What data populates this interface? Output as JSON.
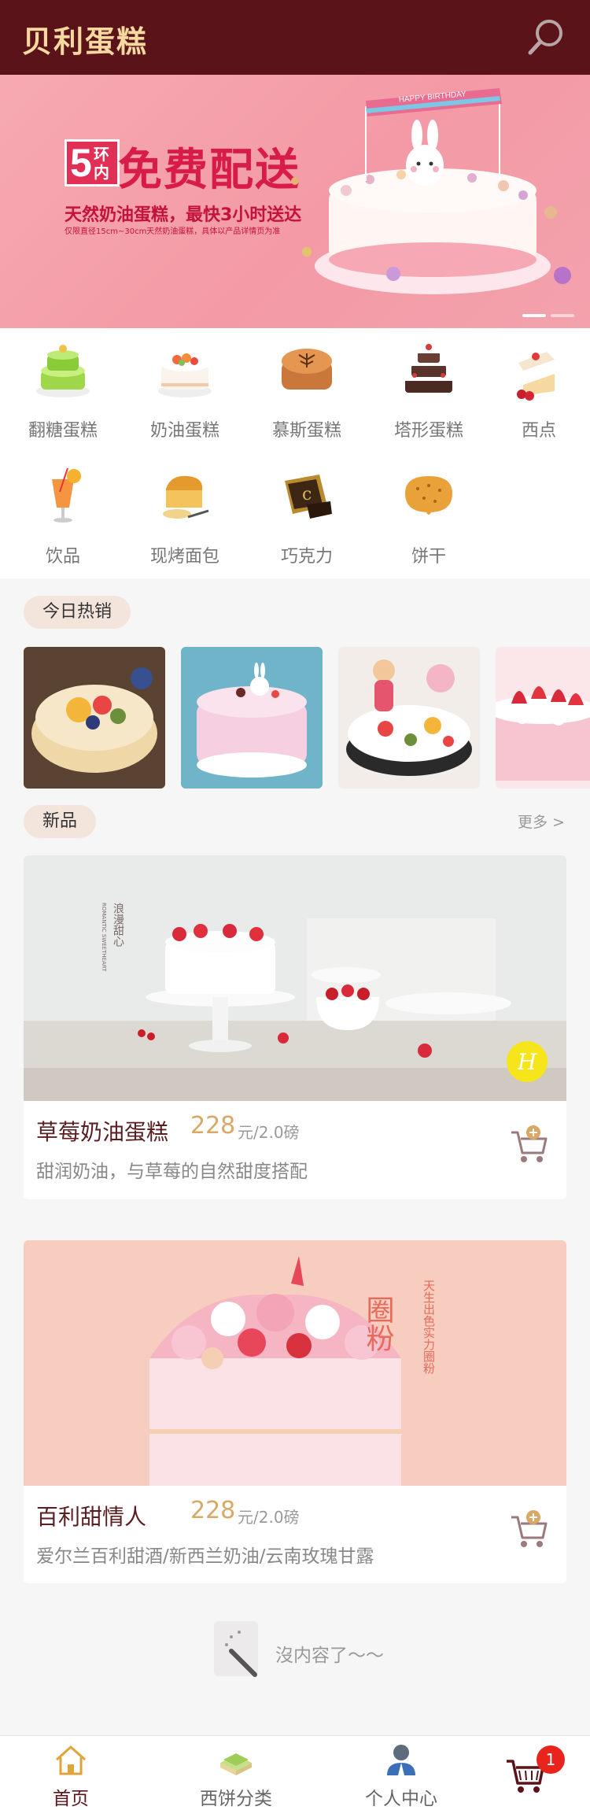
{
  "app": {
    "brand": "贝利蛋糕"
  },
  "banner": {
    "badge_number": "5",
    "badge_text": "环内",
    "title": "免费配送",
    "subtitle": "天然奶油蛋糕，最快3小时送达",
    "fine_print": "仅限直径15cm~30cm天然奶油蛋糕，具体以产品详情页为准",
    "topper_text": "HAPPY BIRTHDAY"
  },
  "categories": [
    {
      "label": "翻糖蛋糕",
      "icon": "fondant-cake-icon"
    },
    {
      "label": "奶油蛋糕",
      "icon": "cream-cake-icon"
    },
    {
      "label": "慕斯蛋糕",
      "icon": "mousse-cake-icon"
    },
    {
      "label": "塔形蛋糕",
      "icon": "tower-cake-icon"
    },
    {
      "label": "西点",
      "icon": "pastry-icon"
    },
    {
      "label": "饮品",
      "icon": "drink-icon"
    },
    {
      "label": "现烤面包",
      "icon": "bread-icon"
    },
    {
      "label": "巧克力",
      "icon": "chocolate-icon"
    },
    {
      "label": "饼干",
      "icon": "cookie-icon"
    }
  ],
  "hot": {
    "title": "今日热销"
  },
  "new_section": {
    "title": "新品",
    "more": "更多 >"
  },
  "products": [
    {
      "name": "草莓奶油蛋糕",
      "price": "228",
      "unit": "元/2.0磅",
      "desc": "甜润奶油，与草莓的自然甜度搭配",
      "photo_text_a": "浪漫甜心",
      "photo_text_b": "ROMANTIC SWEETHEART"
    },
    {
      "name": "百利甜情人",
      "price": "228",
      "unit": "元/2.0磅",
      "desc": "爱尔兰百利甜酒/新西兰奶油/云南玫瑰甘露",
      "photo_text_a": "圈粉",
      "photo_text_b": "天生出色实力圈粉"
    }
  ],
  "empty_text": "沒内容了～～",
  "tabs": [
    {
      "label": "首页",
      "icon": "home-icon"
    },
    {
      "label": "西饼分类",
      "icon": "category-icon"
    },
    {
      "label": "个人中心",
      "icon": "user-icon"
    }
  ],
  "cart_count": "1",
  "colors": {
    "header": "#5a1419",
    "brand_text": "#f6d9a0",
    "accent": "#e8241c",
    "price": "#d9a766"
  }
}
